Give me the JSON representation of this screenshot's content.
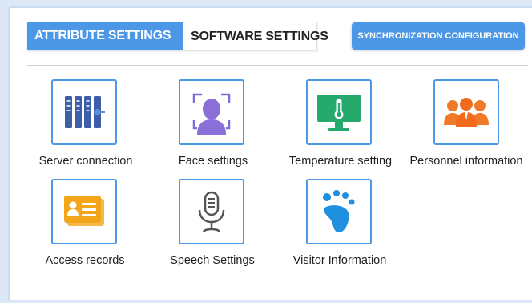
{
  "tabs": [
    {
      "label": "ATTRIBUTE SETTINGS",
      "active": true
    },
    {
      "label": "SOFTWARE SETTINGS",
      "active": false
    }
  ],
  "sync_button": {
    "label": "SYNCHRONIZATION CONFIGURATION"
  },
  "colors": {
    "accent": "#4d98e6",
    "panel_border": "#c9dcf3"
  },
  "items": [
    {
      "label": "Server connection",
      "icon": "server-icon"
    },
    {
      "label": "Face settings",
      "icon": "face-icon"
    },
    {
      "label": "Temperature setting",
      "icon": "thermometer-monitor-icon"
    },
    {
      "label": "Personnel information",
      "icon": "people-icon"
    },
    {
      "label": "Access records",
      "icon": "id-card-icon"
    },
    {
      "label": "Speech Settings",
      "icon": "microphone-icon"
    },
    {
      "label": "Visitor Information",
      "icon": "footprint-icon"
    }
  ]
}
